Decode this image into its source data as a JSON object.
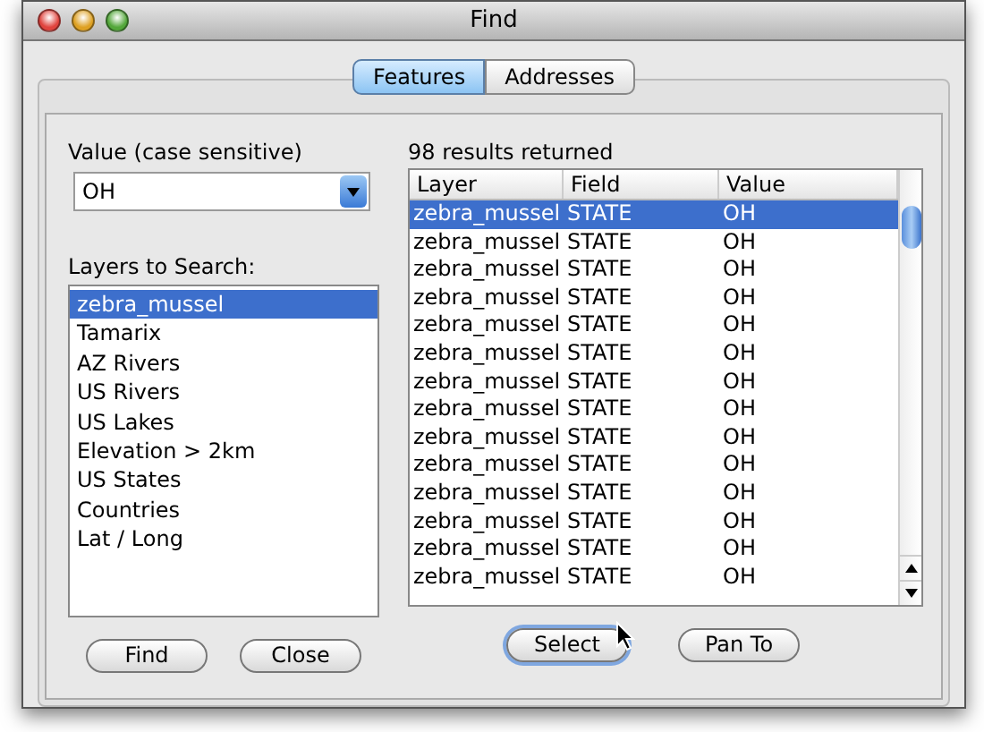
{
  "window": {
    "title": "Find"
  },
  "tabs": [
    {
      "label": "Features",
      "selected": true
    },
    {
      "label": "Addresses",
      "selected": false
    }
  ],
  "search": {
    "value_label": "Value (case sensitive)",
    "value_field": {
      "value": "OH"
    },
    "layers_label": "Layers to Search:",
    "layers": [
      {
        "label": "zebra_mussel",
        "selected": true
      },
      {
        "label": "Tamarix",
        "selected": false
      },
      {
        "label": "AZ Rivers",
        "selected": false
      },
      {
        "label": "US Rivers",
        "selected": false
      },
      {
        "label": "US Lakes",
        "selected": false
      },
      {
        "label": "Elevation > 2km",
        "selected": false
      },
      {
        "label": "US States",
        "selected": false
      },
      {
        "label": "Countries",
        "selected": false
      },
      {
        "label": "Lat / Long",
        "selected": false
      }
    ],
    "buttons": [
      {
        "label": "Find",
        "focused": false
      },
      {
        "label": "Close",
        "focused": false
      }
    ]
  },
  "results": {
    "label": "98 results returned",
    "columns": [
      "Layer",
      "Field",
      "Value"
    ],
    "rows": [
      {
        "cells": [
          "zebra_mussel",
          "STATE",
          "OH"
        ],
        "selected": true
      },
      {
        "cells": [
          "zebra_mussel",
          "STATE",
          "OH"
        ],
        "selected": false
      },
      {
        "cells": [
          "zebra_mussel",
          "STATE",
          "OH"
        ],
        "selected": false
      },
      {
        "cells": [
          "zebra_mussel",
          "STATE",
          "OH"
        ],
        "selected": false
      },
      {
        "cells": [
          "zebra_mussel",
          "STATE",
          "OH"
        ],
        "selected": false
      },
      {
        "cells": [
          "zebra_mussel",
          "STATE",
          "OH"
        ],
        "selected": false
      },
      {
        "cells": [
          "zebra_mussel",
          "STATE",
          "OH"
        ],
        "selected": false
      },
      {
        "cells": [
          "zebra_mussel",
          "STATE",
          "OH"
        ],
        "selected": false
      },
      {
        "cells": [
          "zebra_mussel",
          "STATE",
          "OH"
        ],
        "selected": false
      },
      {
        "cells": [
          "zebra_mussel",
          "STATE",
          "OH"
        ],
        "selected": false
      },
      {
        "cells": [
          "zebra_mussel",
          "STATE",
          "OH"
        ],
        "selected": false
      },
      {
        "cells": [
          "zebra_mussel",
          "STATE",
          "OH"
        ],
        "selected": false
      },
      {
        "cells": [
          "zebra_mussel",
          "STATE",
          "OH"
        ],
        "selected": false
      },
      {
        "cells": [
          "zebra_mussel",
          "STATE",
          "OH"
        ],
        "selected": false
      }
    ],
    "buttons": [
      {
        "label": "Select",
        "focused": true
      },
      {
        "label": "Pan To",
        "focused": false
      }
    ]
  }
}
